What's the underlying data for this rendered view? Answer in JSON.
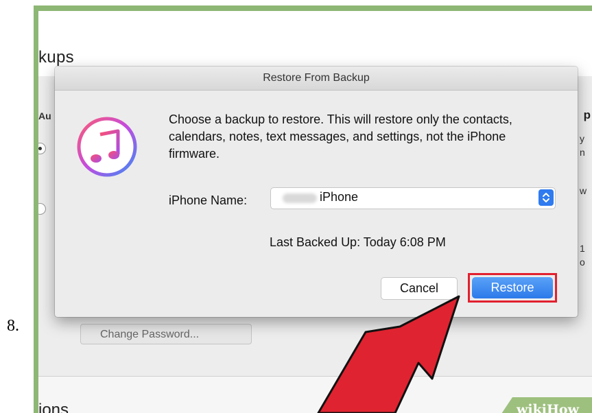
{
  "step_number": "8.",
  "background": {
    "backups_heading": "kups",
    "left_fragment": "Au",
    "right_fragment_bold": "p",
    "right_fragments": [
      "y",
      "n",
      "w",
      "1",
      "o"
    ],
    "change_password_label": "Change Password...",
    "options_heading": "ions"
  },
  "dialog": {
    "title": "Restore From Backup",
    "app_icon": "itunes-music-note-icon",
    "message": "Choose a backup to restore. This will restore only the contacts, calendars, notes, text messages, and settings, not the iPhone firmware.",
    "name_label": "iPhone Name:",
    "name_value": "iPhone",
    "last_backup": "Last Backed Up: Today 6:08 PM",
    "cancel_label": "Cancel",
    "restore_label": "Restore"
  },
  "watermark": {
    "text": "wikiHow"
  },
  "colors": {
    "frame_green": "#8db774",
    "accent_blue": "#2b79ea",
    "highlight_red": "#e2202e",
    "arrow_red": "#e02330"
  }
}
